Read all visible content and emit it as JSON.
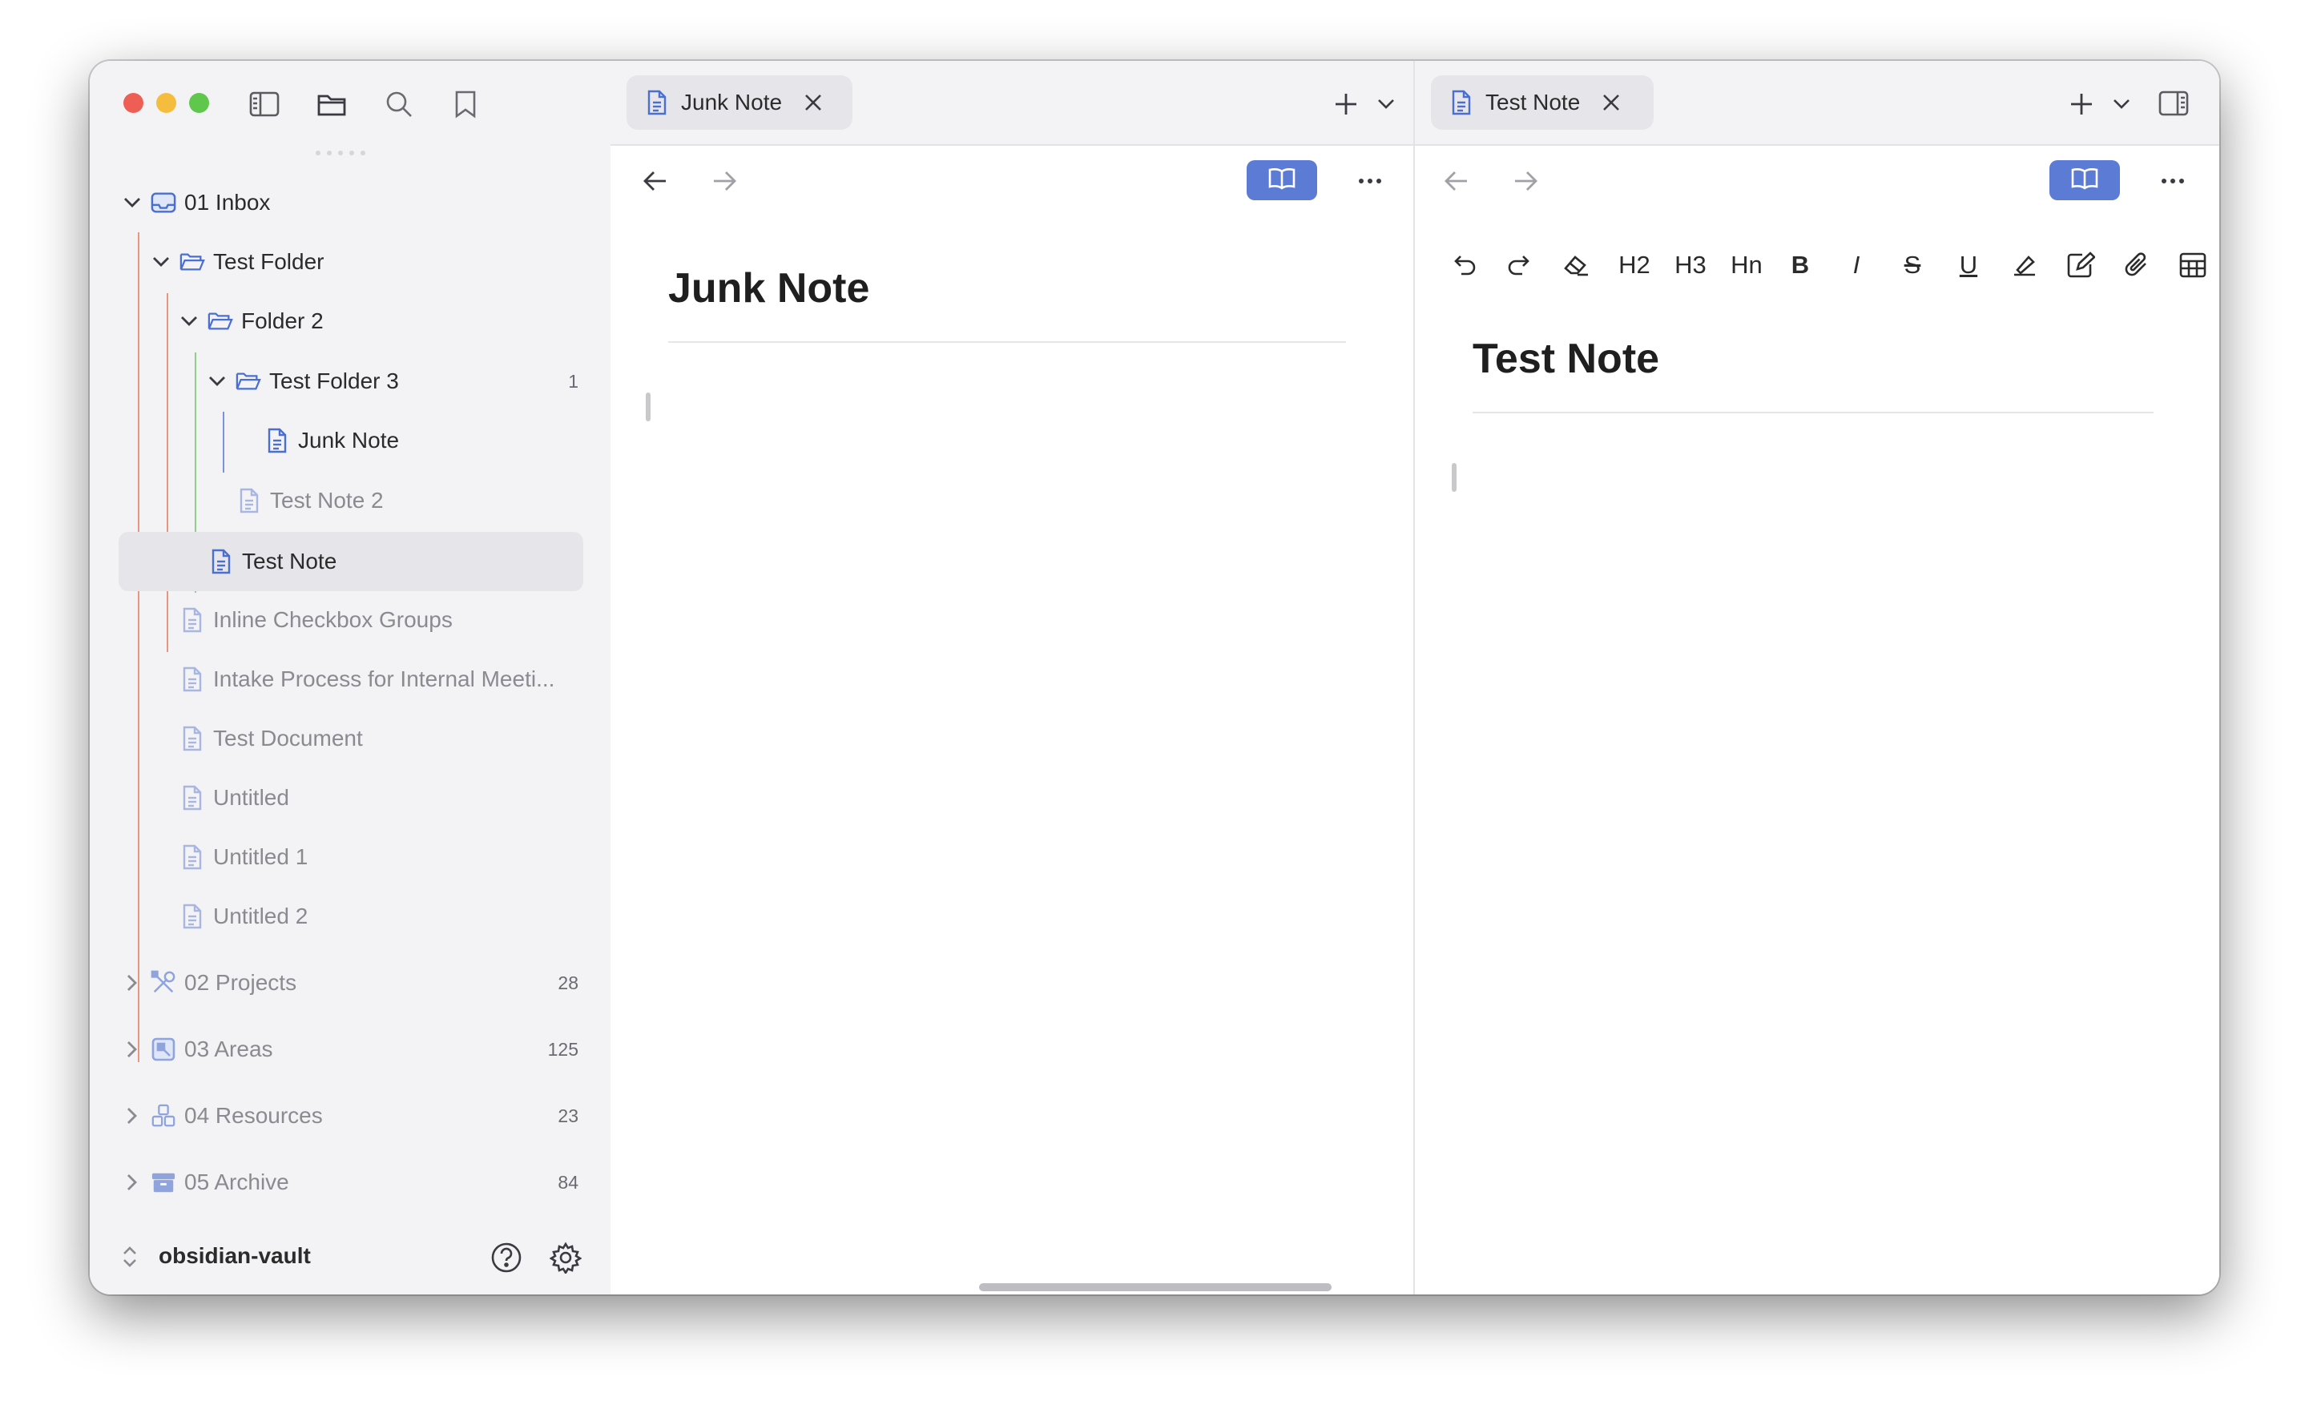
{
  "window": {
    "traffic_lights": [
      "close",
      "minimize",
      "zoom"
    ],
    "colors": {
      "red": "#ee5e55",
      "yellow": "#f4bd3e",
      "green": "#5fc74c",
      "accent": "#5b7bd5"
    }
  },
  "sidebar": {
    "toolbar_icons": [
      "sidebar-toggle-icon",
      "folder-icon",
      "search-icon",
      "bookmark-icon"
    ],
    "tree": {
      "inbox": {
        "label": "01 Inbox"
      },
      "test_folder": {
        "label": "Test Folder"
      },
      "folder_2": {
        "label": "Folder 2"
      },
      "test_folder_3": {
        "label": "Test Folder 3",
        "count": "1"
      },
      "junk_note": {
        "label": "Junk Note"
      },
      "test_note_2": {
        "label": "Test Note 2"
      },
      "test_note": {
        "label": "Test Note"
      },
      "inline_checkbox": {
        "label": "Inline Checkbox Groups"
      },
      "intake_process": {
        "label": "Intake Process for Internal Meeti..."
      },
      "test_document": {
        "label": "Test Document"
      },
      "untitled": {
        "label": "Untitled"
      },
      "untitled_1": {
        "label": "Untitled 1"
      },
      "untitled_2": {
        "label": "Untitled 2"
      },
      "projects": {
        "label": "02 Projects",
        "count": "28"
      },
      "areas": {
        "label": "03 Areas",
        "count": "125"
      },
      "resources": {
        "label": "04 Resources",
        "count": "23"
      },
      "archive": {
        "label": "05 Archive",
        "count": "84"
      }
    },
    "footer": {
      "vault_name": "obsidian-vault"
    }
  },
  "left_pane": {
    "tab_label": "Junk Note",
    "note_title": "Junk Note"
  },
  "right_pane": {
    "tab_label": "Test Note",
    "note_title": "Test Note",
    "format_toolbar": {
      "h2": "H2",
      "h3": "H3",
      "hn": "Hn",
      "bold": "B",
      "italic": "I",
      "strike": "S",
      "underline": "U"
    }
  }
}
